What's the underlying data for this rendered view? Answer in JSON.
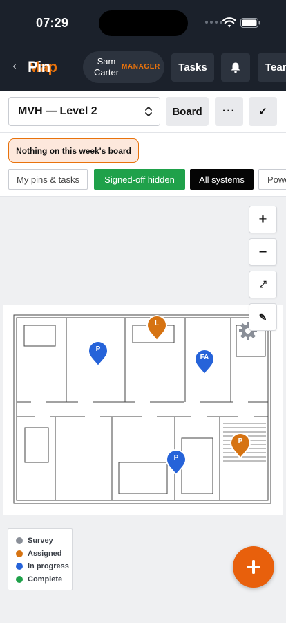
{
  "status_bar": {
    "time": "07:29"
  },
  "header": {
    "brand_pin": "Pin",
    "brand_map": "Map",
    "user_name": "Sam Carter",
    "user_role": "MANAGER",
    "tasks_label": "Tasks",
    "team_label": "Team"
  },
  "toolbar": {
    "level": "MVH — Level 2",
    "board_label": "Board",
    "more_label": "···",
    "check_label": "✓"
  },
  "alert": {
    "text": "Nothing on this week's board"
  },
  "filters": {
    "mine": "My pins & tasks",
    "signed_off": "Signed-off hidden",
    "systems": "All systems",
    "power": "Power"
  },
  "map_controls": {
    "zoom_in": "+",
    "zoom_out": "−",
    "fit": "⤢",
    "draw": "✎"
  },
  "pins": [
    {
      "label": "L",
      "status": "Assigned",
      "color": "#d67312"
    },
    {
      "label": "P",
      "status": "In progress",
      "color": "#2663d9"
    },
    {
      "label": "FA",
      "status": "In progress",
      "color": "#2663d9"
    },
    {
      "label": "P",
      "status": "In progress",
      "color": "#2663d9"
    },
    {
      "label": "P",
      "status": "Assigned",
      "color": "#d67312"
    }
  ],
  "legend": [
    {
      "label": "Survey",
      "color": "#8a8f98"
    },
    {
      "label": "Assigned",
      "color": "#d67312"
    },
    {
      "label": "In progress",
      "color": "#2663d9"
    },
    {
      "label": "Complete",
      "color": "#1fa14a"
    }
  ],
  "colors": {
    "accent": "#e8720c",
    "fab": "#e8600c",
    "header_bg": "#1b212b"
  }
}
